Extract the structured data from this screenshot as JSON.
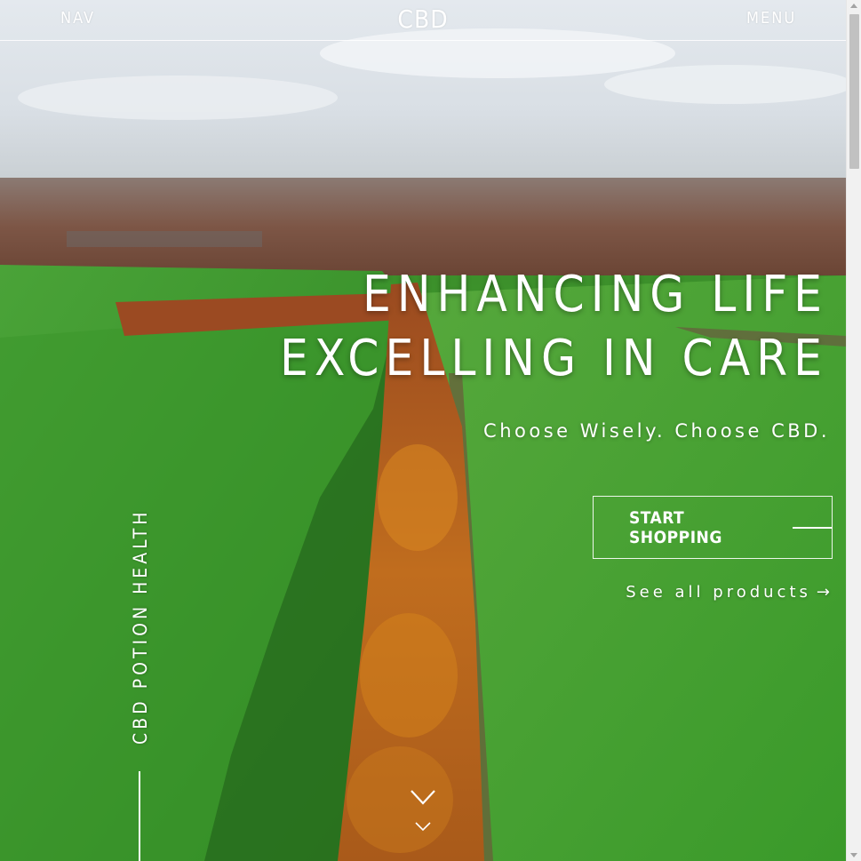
{
  "header": {
    "nav_label": "NAV",
    "logo_text": "CBD",
    "menu_label": "MENU"
  },
  "hero": {
    "headline_line1": "ENHANCING LIFE",
    "headline_line2": "EXCELLING IN CARE",
    "tagline": "Choose Wisely. Choose CBD.",
    "cta_label": "START SHOPPING",
    "see_all_label": "See all products",
    "see_all_arrow": "→",
    "vertical_brand": "CBD POTION HEALTH",
    "scroll_icon": "chevron-double-down-icon",
    "background": "aerial-autumn-treeline-green-fields"
  },
  "colors": {
    "text": "#ffffff",
    "field_green": "#3c9a2c",
    "tree_orange": "#b8641e",
    "sky": "#e6eaee"
  }
}
